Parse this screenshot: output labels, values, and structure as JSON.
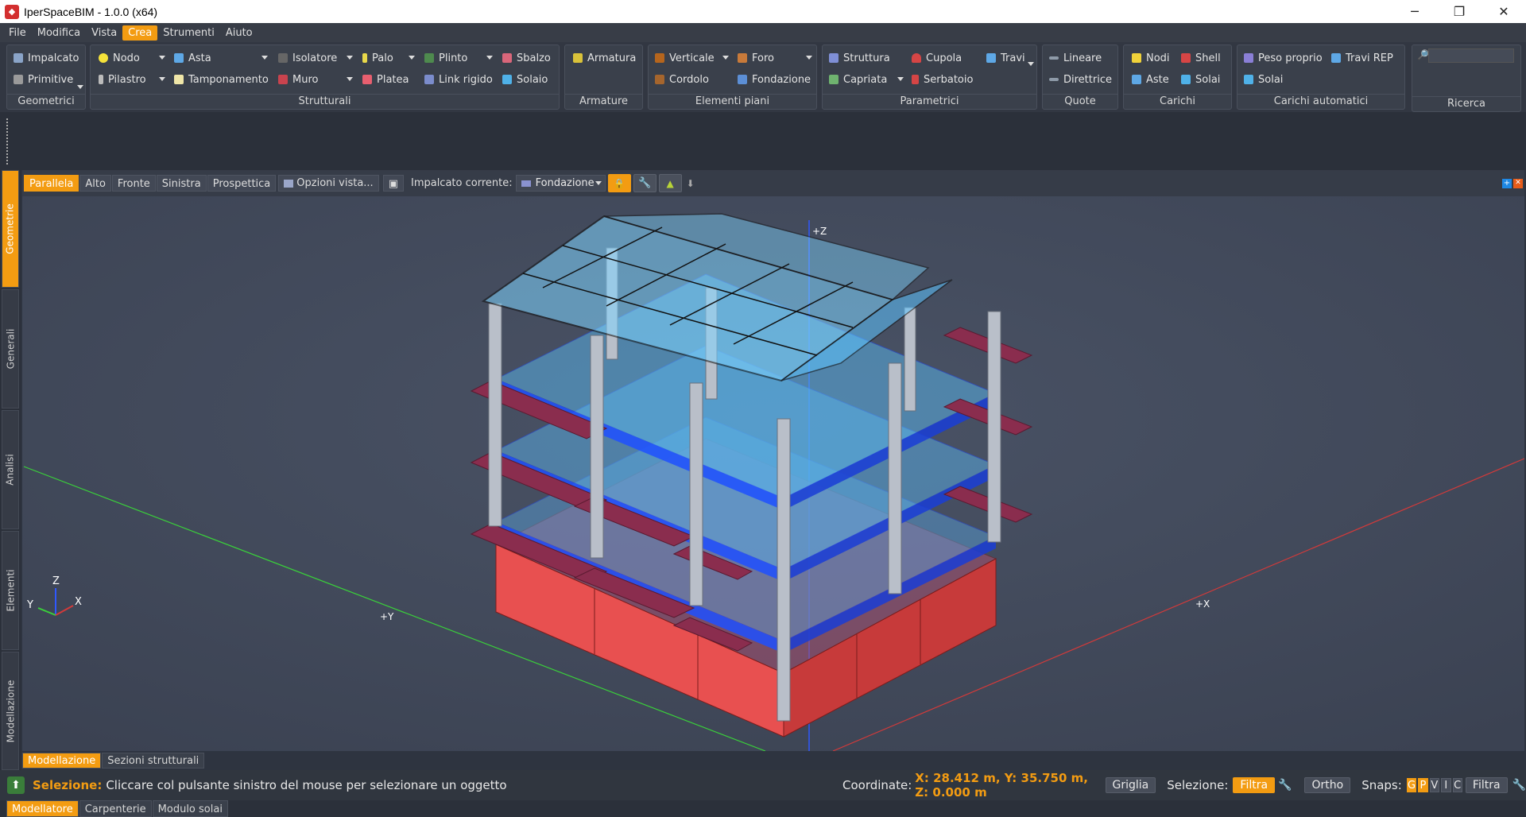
{
  "window": {
    "title": "IperSpaceBIM - 1.0.0 (x64)",
    "minimize": "─",
    "maximize": "❐",
    "close": "✕"
  },
  "menu": [
    "File",
    "Modifica",
    "Vista",
    "Crea",
    "Strumenti",
    "Aiuto"
  ],
  "ribbon": {
    "geometrici": {
      "label": "Geometrici",
      "items": [
        "Impalcato",
        "Primitive"
      ]
    },
    "strutturali": {
      "label": "Strutturali",
      "items": [
        "Nodo",
        "Asta",
        "Isolatore",
        "Palo",
        "Plinto",
        "Sbalzo",
        "Pilastro",
        "Tamponamento",
        "Muro",
        "Platea",
        "Link rigido",
        "Solaio"
      ]
    },
    "armature": {
      "label": "Armature",
      "items": [
        "Armatura"
      ]
    },
    "elementi_piani": {
      "label": "Elementi piani",
      "items": [
        "Verticale",
        "Foro",
        "Cordolo",
        "Fondazione"
      ]
    },
    "parametrici": {
      "label": "Parametrici",
      "items": [
        "Struttura",
        "Cupola",
        "Travi",
        "Capriata",
        "Serbatoio"
      ]
    },
    "quote": {
      "label": "Quote",
      "items": [
        "Lineare",
        "Direttrice"
      ]
    },
    "carichi": {
      "label": "Carichi",
      "items": [
        "Nodi",
        "Shell",
        "Aste",
        "Solai"
      ]
    },
    "carichi_automatici": {
      "label": "Carichi automatici",
      "items": [
        "Peso proprio",
        "Travi REP",
        "Solai"
      ]
    },
    "ricerca": {
      "label": "Ricerca"
    }
  },
  "sidetabs": [
    "Geometrie",
    "Generali",
    "Analisi",
    "Elementi",
    "Modellazione"
  ],
  "viewbar": {
    "views": [
      "Parallela",
      "Alto",
      "Fronte",
      "Sinistra",
      "Prospettica"
    ],
    "options_label": "Opzioni vista...",
    "impalcato_label": "Impalcato corrente:",
    "impalcato_value": "Fondazione"
  },
  "viewport": {
    "axis_z": "+Z",
    "axis_y": "+Y",
    "axis_x": "+X",
    "gizmo": {
      "z": "Z",
      "y": "Y",
      "x": "X"
    }
  },
  "bottom_tabs": [
    "Modellazione",
    "Sezioni strutturali"
  ],
  "status": {
    "label": "Selezione:",
    "message": "Cliccare col pulsante sinistro del mouse per selezionare un oggetto",
    "coord_label": "Coordinate:",
    "coord_value": "X: 28.412 m, Y: 35.750 m, Z: 0.000 m",
    "griglia": "Griglia",
    "selezione_label": "Selezione:",
    "filtra": "Filtra",
    "ortho": "Ortho",
    "snaps_label": "Snaps:",
    "snaps": [
      "G",
      "P",
      "V",
      "I",
      "C"
    ],
    "filtra2": "Filtra"
  },
  "app_tabs": [
    "Modellatore",
    "Carpenterie",
    "Modulo solai"
  ],
  "colors": {
    "accent": "#f39c12",
    "foundation": "#ff5a5a",
    "slab_blue": "#1e6cff",
    "glass": "#7fd4ff",
    "balcony": "#8a2d4e"
  }
}
